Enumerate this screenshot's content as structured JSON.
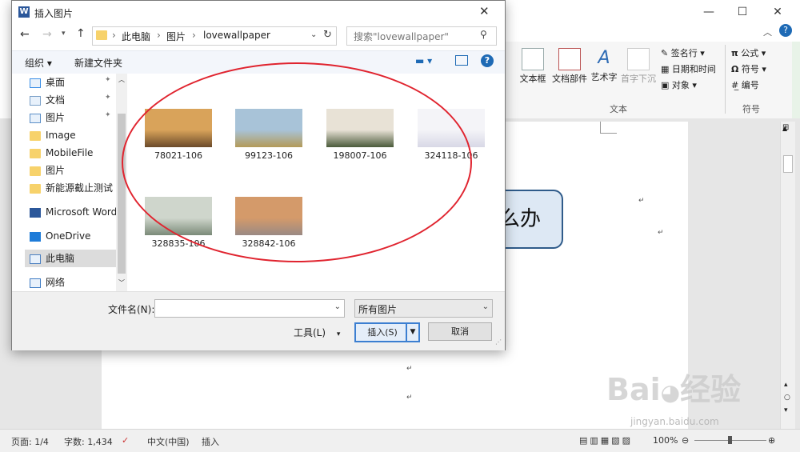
{
  "dialog": {
    "title": "插入图片",
    "breadcrumb": [
      "此电脑",
      "图片",
      "lovewallpaper"
    ],
    "search_placeholder": "搜索\"lovewallpaper\"",
    "toolbar": {
      "organize": "组织",
      "new_folder": "新建文件夹"
    },
    "nav_items": [
      {
        "label": "桌面",
        "icon": "desktop-icon",
        "pinned": true
      },
      {
        "label": "文档",
        "icon": "document-icon",
        "pinned": true
      },
      {
        "label": "图片",
        "icon": "pictures-icon",
        "pinned": true
      },
      {
        "label": "Image",
        "icon": "folder-icon",
        "pinned": false
      },
      {
        "label": "MobileFile",
        "icon": "folder-icon",
        "pinned": false
      },
      {
        "label": "图片",
        "icon": "folder-icon",
        "pinned": false
      },
      {
        "label": "新能源截止测试",
        "icon": "folder-icon",
        "pinned": false
      },
      {
        "label": "Microsoft Word",
        "icon": "word-icon",
        "pinned": false
      },
      {
        "label": "OneDrive",
        "icon": "onedrive-icon",
        "pinned": false
      },
      {
        "label": "此电脑",
        "icon": "computer-icon",
        "pinned": false,
        "selected": true
      },
      {
        "label": "网络",
        "icon": "network-icon",
        "pinned": false
      }
    ],
    "files": [
      {
        "name": "78021-106",
        "colors": [
          "#d9a35a",
          "#6b4a2a"
        ]
      },
      {
        "name": "99123-106",
        "colors": [
          "#a8c3d8",
          "#b39a58"
        ]
      },
      {
        "name": "198007-106",
        "colors": [
          "#e8e2d6",
          "#4a5a3a"
        ]
      },
      {
        "name": "324118-106",
        "colors": [
          "#f4f4f8",
          "#d8d8e6"
        ]
      },
      {
        "name": "328835-106",
        "colors": [
          "#cfd6cc",
          "#7a8a78"
        ]
      },
      {
        "name": "328842-106",
        "colors": [
          "#d49a6a",
          "#9a8a84"
        ]
      }
    ],
    "filename_label": "文件名(N):",
    "filename_value": "",
    "filter_value": "所有图片",
    "tools_label": "工具(L)",
    "insert_label": "插入(S)",
    "cancel_label": "取消"
  },
  "ribbon": {
    "text_box": "文本框",
    "doc_parts": "文档部件",
    "wordart": "艺术字",
    "dropcap": "首字下沉",
    "signature": "签名行",
    "datetime": "日期和时间",
    "object": "对象",
    "group_text": "文本",
    "equation": "公式",
    "symbol": "符号",
    "number": "编号",
    "group_symbols": "符号"
  },
  "document": {
    "callout_text": "么办"
  },
  "status": {
    "page": "页面: 1/4",
    "words": "字数: 1,434",
    "language": "中文(中国)",
    "mode": "插入",
    "zoom": "100%"
  },
  "watermark": {
    "brand": "Bai",
    "brand2": "经验",
    "url": "jingyan.baidu.com"
  }
}
